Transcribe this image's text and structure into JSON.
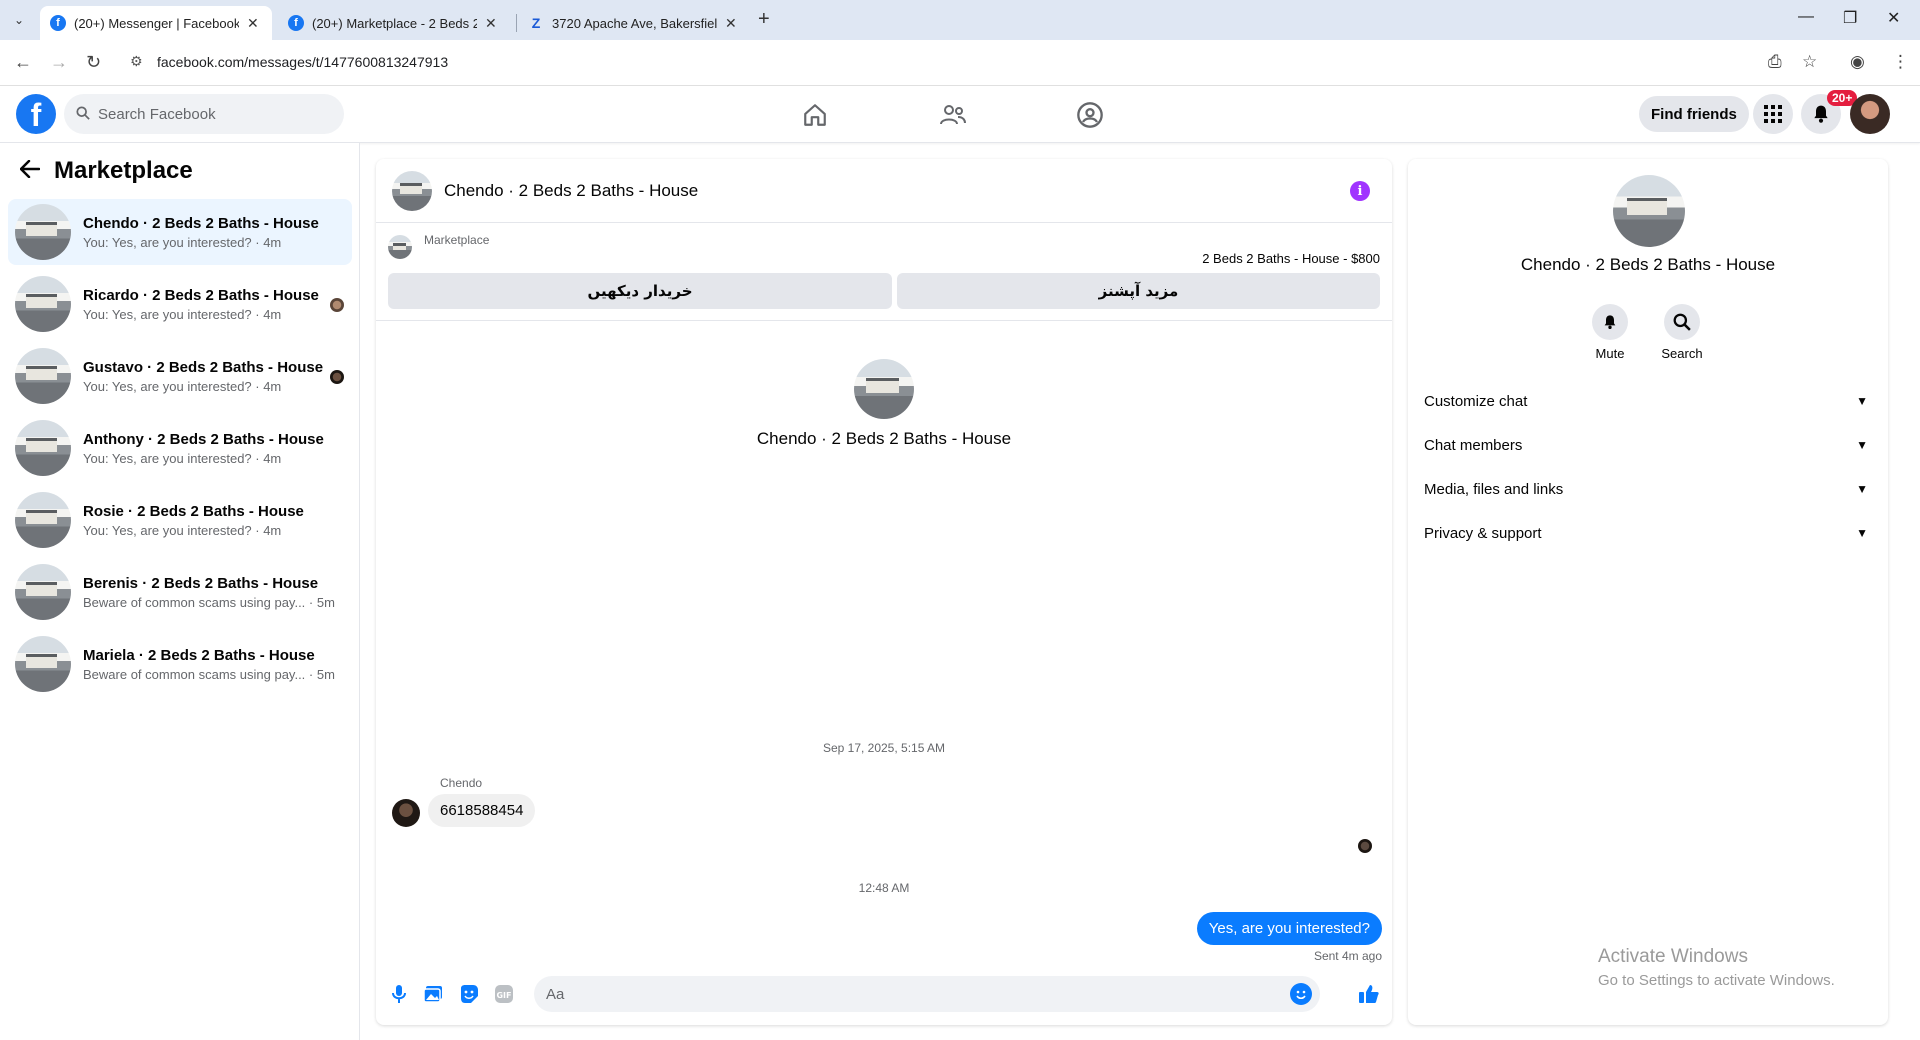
{
  "browser": {
    "tabs": [
      {
        "label": "(20+) Messenger | Facebook",
        "active": true
      },
      {
        "label": "(20+) Marketplace - 2 Beds 2 Ba",
        "active": false
      },
      {
        "label": "3720 Apache Ave, Bakersfield, C",
        "active": false
      }
    ],
    "url": "facebook.com/messages/t/1477600813247913"
  },
  "header": {
    "search_placeholder": "Search Facebook",
    "find_friends": "Find friends",
    "notif_count": "20+"
  },
  "sidebar": {
    "title": "Marketplace",
    "conversations": [
      {
        "name": "Chendo · 2 Beds 2 Baths - House",
        "preview": "You: Yes, are you interested? · 4m"
      },
      {
        "name": "Ricardo · 2 Beds 2 Baths - House",
        "preview": "You: Yes, are you interested? · 4m"
      },
      {
        "name": "Gustavo · 2 Beds 2 Baths - House",
        "preview": "You: Yes, are you interested? · 4m"
      },
      {
        "name": "Anthony · 2 Beds 2 Baths - House",
        "preview": "You: Yes, are you interested? · 4m"
      },
      {
        "name": "Rosie · 2 Beds 2 Baths - House",
        "preview": "You: Yes, are you interested? · 4m"
      },
      {
        "name": "Berenis · 2 Beds 2 Baths - House",
        "preview": "Beware of common scams using pay... · 5m"
      },
      {
        "name": "Mariela · 2 Beds 2 Baths - House",
        "preview": "Beware of common scams using pay... · 5m"
      }
    ]
  },
  "chat": {
    "title": "Chendo · 2 Beds 2 Baths - House",
    "marketplace_label": "Marketplace",
    "listing": "2 Beds 2 Baths - House - $800",
    "btn_left": "خریدار دیکھیں",
    "btn_right": "مزید آپشنز",
    "intro_name": "Chendo · 2 Beds 2 Baths - House",
    "timestamp1": "Sep 17, 2025, 5:15 AM",
    "sender": "Chendo",
    "incoming": "6618588454",
    "timestamp2": "12:48 AM",
    "outgoing": "Yes, are you interested?",
    "sent_status": "Sent 4m ago",
    "composer_placeholder": "Aa"
  },
  "details": {
    "name": "Chendo · 2 Beds 2 Baths - House",
    "mute": "Mute",
    "search": "Search",
    "sections": [
      "Customize chat",
      "Chat members",
      "Media, files and links",
      "Privacy & support"
    ]
  },
  "watermark": {
    "line1": "Activate Windows",
    "line2": "Go to Settings to activate Windows."
  },
  "colors": {
    "brand": "#1877f2",
    "messenger_blue": "#0a7cff",
    "info_purple": "#a033ff",
    "badge_red": "#e41e3f"
  }
}
